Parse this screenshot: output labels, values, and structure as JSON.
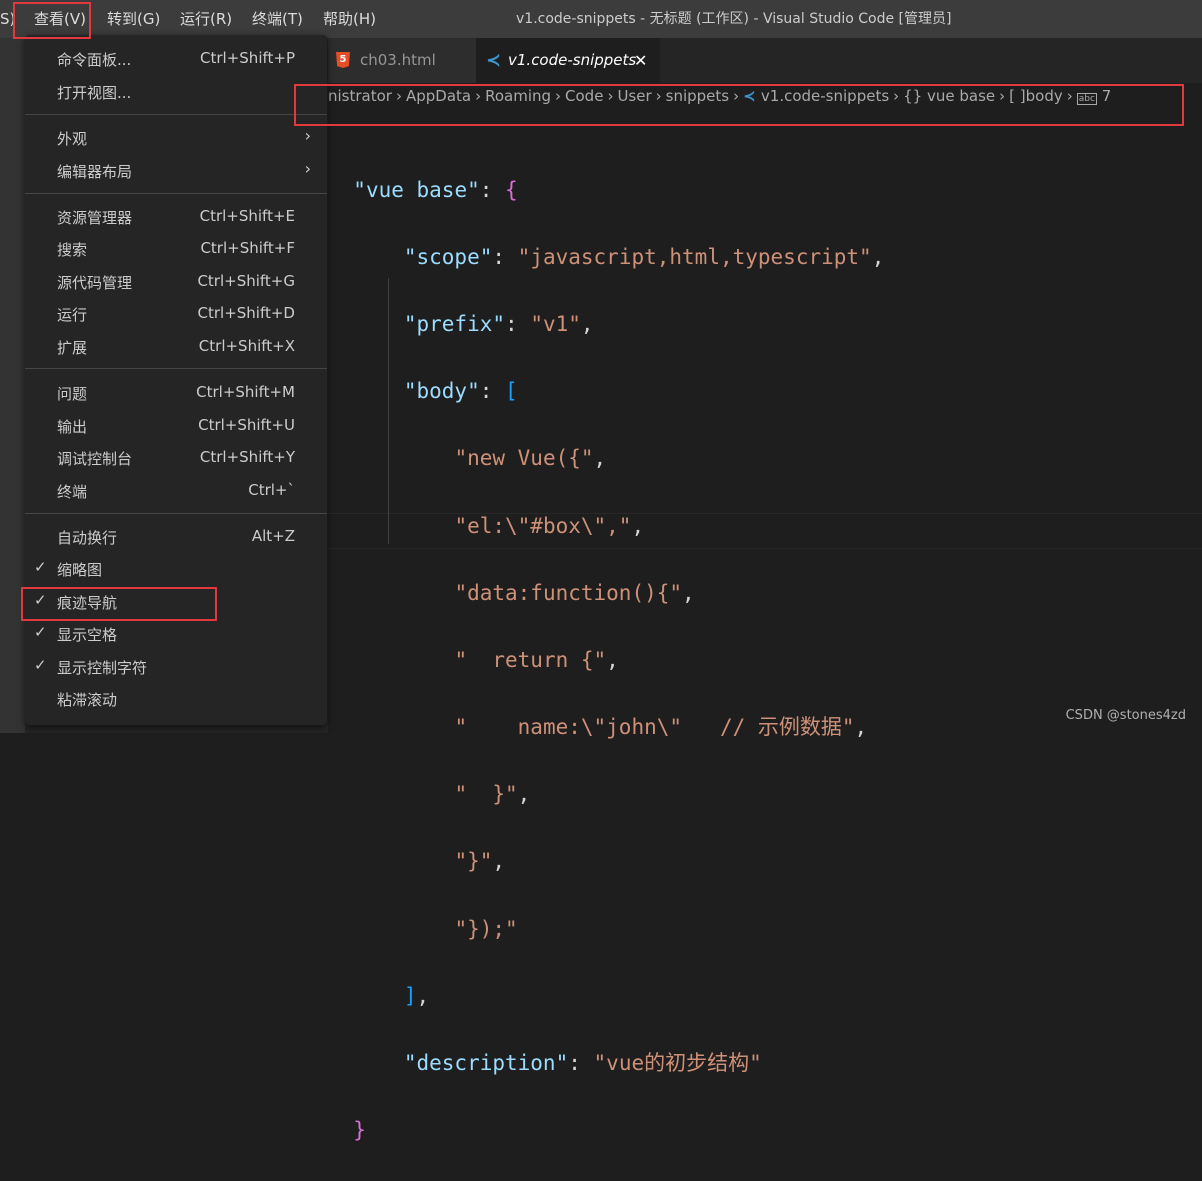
{
  "menubar": {
    "partial": "S)",
    "view": "查看(V)",
    "go": "转到(G)",
    "run": "运行(R)",
    "terminal": "终端(T)",
    "help": "帮助(H)"
  },
  "window_title": "v1.code-snippets - 无标题 (工作区) - Visual Studio Code [管理员]",
  "tabs": [
    {
      "label": "ch03.html",
      "icon": "html5-icon"
    },
    {
      "label": "v1.code-snippets",
      "icon": "vscode-icon",
      "close": "✕"
    }
  ],
  "breadcrumb": {
    "items": [
      "nistrator",
      "AppData",
      "Roaming",
      "Code",
      "User",
      "snippets"
    ],
    "file": "v1.code-snippets",
    "obj": "vue base",
    "body": "body",
    "last": "7",
    "sep": "›",
    "obj_icon": "{}",
    "arr_icon": "[ ]"
  },
  "code": {
    "l1_key": "\"vue base\"",
    "colon": ": ",
    "open_brace": "{",
    "close_brace": "}",
    "comma": ",",
    "l2_key": "\"scope\"",
    "l2_val": "\"javascript,html,typescript\"",
    "l3_key": "\"prefix\"",
    "l3_val": "\"v1\"",
    "l4_key": "\"body\"",
    "open_bracket": "[",
    "close_bracket": "]",
    "b1": "\"new Vue({\"",
    "b2": "\"el:\\\"#box\\\",\"",
    "b3": "\"data:function(){\"",
    "b4": "\"  return {\"",
    "b5a": "\"    name:\\\"john\\\"   ",
    "b5b": "// 示例数据",
    "b5c": "\"",
    "b6": "\"  }\"",
    "b7": "\"}\"",
    "b8": "\"});\"",
    "l_desc_key": "\"description\"",
    "l_desc_val": "\"vue的初步结构\""
  },
  "menu": {
    "items": [
      {
        "label": "命令面板...",
        "shortcut": "Ctrl+Shift+P"
      },
      {
        "label": "打开视图...",
        "shortcut": ""
      },
      {
        "label": "外观",
        "submenu": "›"
      },
      {
        "label": "编辑器布局",
        "submenu": "›"
      },
      {
        "label": "资源管理器",
        "shortcut": "Ctrl+Shift+E"
      },
      {
        "label": "搜索",
        "shortcut": "Ctrl+Shift+F"
      },
      {
        "label": "源代码管理",
        "shortcut": "Ctrl+Shift+G"
      },
      {
        "label": "运行",
        "shortcut": "Ctrl+Shift+D"
      },
      {
        "label": "扩展",
        "shortcut": "Ctrl+Shift+X"
      },
      {
        "label": "问题",
        "shortcut": "Ctrl+Shift+M"
      },
      {
        "label": "输出",
        "shortcut": "Ctrl+Shift+U"
      },
      {
        "label": "调试控制台",
        "shortcut": "Ctrl+Shift+Y"
      },
      {
        "label": "终端",
        "shortcut": "Ctrl+`"
      },
      {
        "label": "自动换行",
        "shortcut": "Alt+Z"
      },
      {
        "label": "缩略图",
        "check": "✓"
      },
      {
        "label": "痕迹导航",
        "check": "✓"
      },
      {
        "label": "显示空格",
        "check": "✓"
      },
      {
        "label": "显示控制字符",
        "check": "✓"
      },
      {
        "label": "粘滞滚动"
      }
    ]
  },
  "watermark": "CSDN @stones4zd",
  "colors": {
    "highlight_box": "#e0393e",
    "keyword": "#9cdcfe",
    "string": "#ce9178"
  }
}
